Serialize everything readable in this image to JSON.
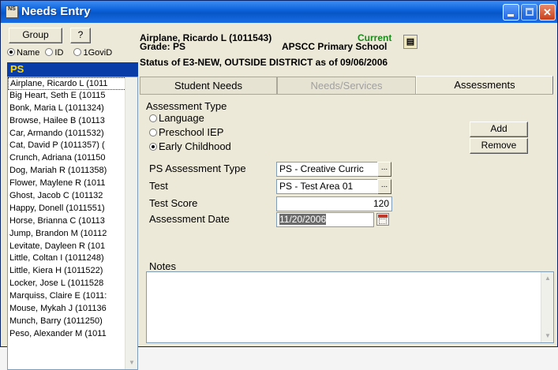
{
  "window": {
    "title": "Needs Entry",
    "icon_label": "NS"
  },
  "left": {
    "group_label": "Group",
    "help_label": "?",
    "radio_name": "Name",
    "radio_id": "ID",
    "radio_gov": "1GoviD",
    "selected_group": "PS",
    "students": [
      "Airplane, Ricardo L (1011",
      "Big Heart, Seth E (10115",
      "Bonk, Maria L (1011324)",
      "Browse, Hailee B (10113",
      "Car, Armando (1011532)",
      "Cat, David P (1011357) (",
      "Crunch, Adriana (101150",
      "Dog, Mariah R (1011358)",
      "Flower, Maylene R (1011",
      "Ghost, Jacob C (101132",
      "Happy, Donell (1011551)",
      "Horse, Brianna C (10113",
      "Jump, Brandon M (10112",
      "Levitate, Dayleen R (101",
      "Little, Coltan I (1011248)",
      "Little, Kiera H (1011522)",
      "Locker, Jose L (1011528",
      "Marquiss, Claire E (1011:",
      "Mouse, Mykah J (101136",
      "Munch, Barry (1011250)",
      "Peso, Alexander M (1011"
    ]
  },
  "header": {
    "student_name": "Airplane, Ricardo L (1011543)",
    "grade": "Grade: PS",
    "current": "Current",
    "school": "APSCC Primary School",
    "status": "Status of E3-NEW, OUTSIDE DISTRICT as of 09/06/2006"
  },
  "tabs": [
    "Student Needs",
    "Needs/Services",
    "Assessments"
  ],
  "form": {
    "assessment_type_label": "Assessment Type",
    "options": [
      "Language",
      "Preschool IEP",
      "Early Childhood"
    ],
    "selected_option": "Early Childhood",
    "add_label": "Add",
    "remove_label": "Remove",
    "ps_assessment_type_label": "PS Assessment Type",
    "ps_assessment_type_value": "PS - Creative Curric",
    "test_label": "Test",
    "test_value": "PS - Test Area 01",
    "test_score_label": "Test Score",
    "test_score_value": "120",
    "assessment_date_label": "Assessment Date",
    "assessment_date_value": "11/20/2006",
    "notes_label": "Notes",
    "notes_value": ""
  },
  "colors": {
    "title_bar": "#0a5fd8",
    "group_bar": "#0a3ca8",
    "group_text": "#ffd800",
    "current_text": "#1b8a1b"
  }
}
